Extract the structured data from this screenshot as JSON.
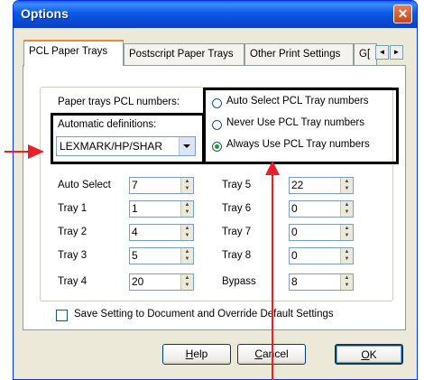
{
  "window": {
    "title": "Options",
    "close_glyph": "✕"
  },
  "tabs": [
    "PCL Paper Trays",
    "Postscript Paper Trays",
    "Other Print Settings",
    "G["
  ],
  "tab_scroll": {
    "left": "◄",
    "right": "►"
  },
  "panel": {
    "paper_trays_label": "Paper trays PCL numbers:",
    "auto_def_label": "Automatic definitions:",
    "auto_def_value": "LEXMARK/HP/SHAR",
    "radios": [
      {
        "label": "Auto Select PCL Tray numbers",
        "selected": false
      },
      {
        "label": "Never Use PCL Tray numbers",
        "selected": false
      },
      {
        "label": "Always Use PCL Tray numbers",
        "selected": true
      }
    ],
    "trays_left": [
      {
        "label": "Auto Select",
        "value": "7"
      },
      {
        "label": "Tray 1",
        "value": "1"
      },
      {
        "label": "Tray 2",
        "value": "4"
      },
      {
        "label": "Tray 3",
        "value": "5"
      },
      {
        "label": "Tray 4",
        "value": "20"
      }
    ],
    "trays_right": [
      {
        "label": "Tray 5",
        "value": "22"
      },
      {
        "label": "Tray 6",
        "value": "0"
      },
      {
        "label": "Tray 7",
        "value": "0"
      },
      {
        "label": "Tray 8",
        "value": "0"
      },
      {
        "label": "Bypass",
        "value": "8"
      }
    ],
    "save_checkbox_label": "Save Setting to Document and Override Default Settings"
  },
  "buttons": {
    "help": {
      "accel": "H",
      "rest": "elp"
    },
    "cancel": {
      "accel": "C",
      "rest": "ancel"
    },
    "ok": {
      "accel": "O",
      "rest": "K"
    }
  },
  "colors": {
    "title_bar": "#0A5FF0",
    "close_button": "#C94418",
    "annotation_arrow": "#E8202A",
    "tab_highlight": "#E68B2C"
  }
}
